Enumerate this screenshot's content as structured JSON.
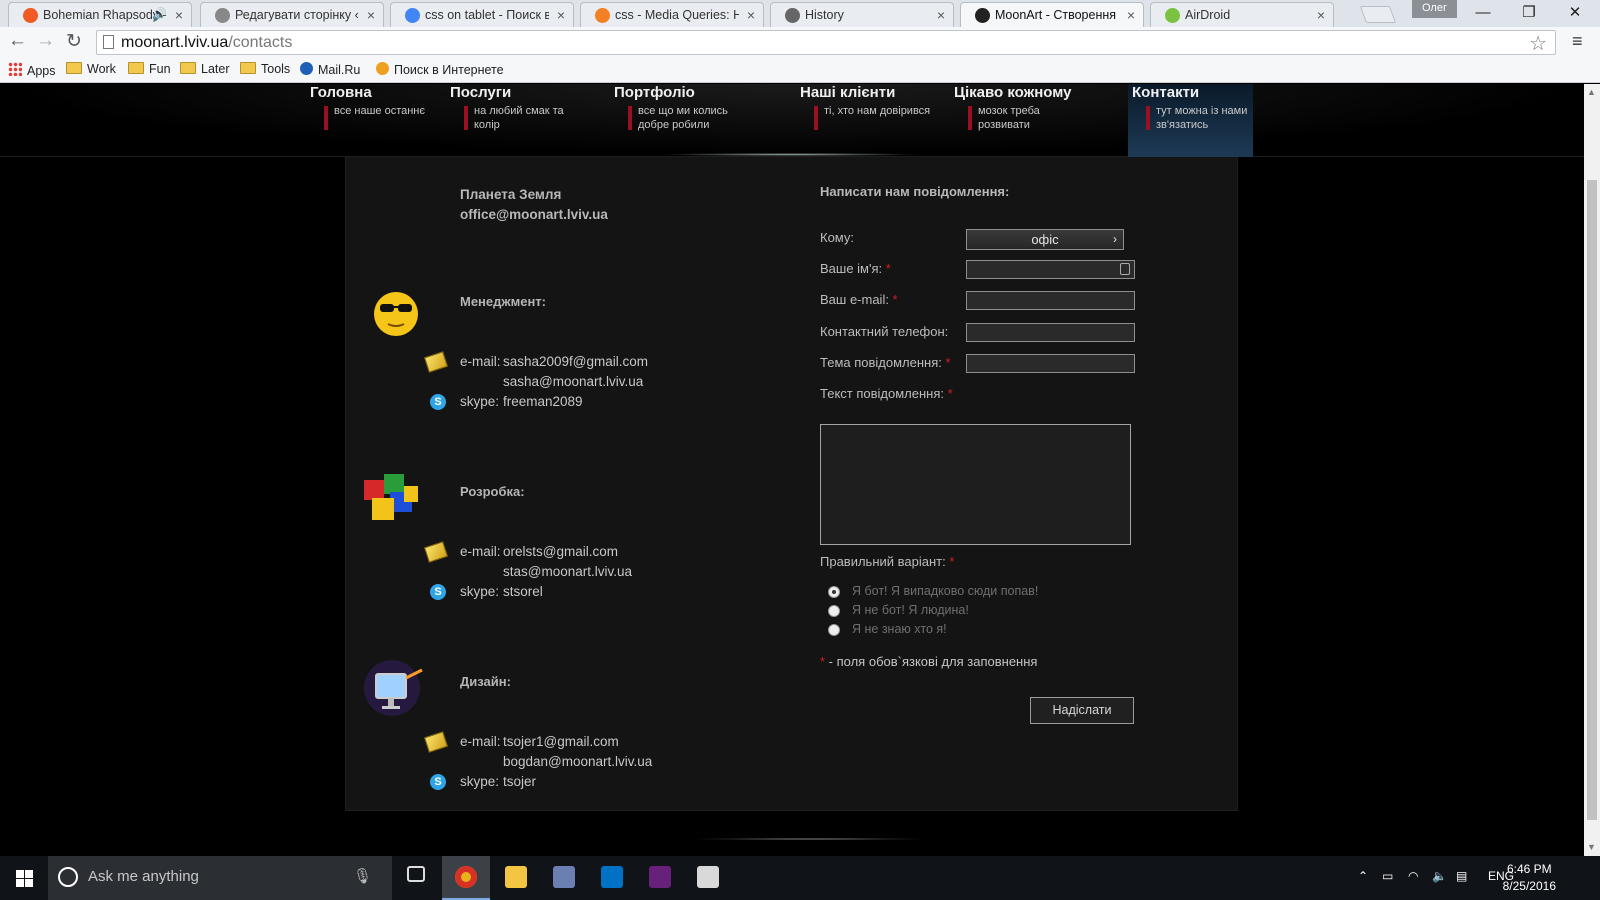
{
  "browser": {
    "tabs": [
      {
        "title": "Bohemian Rhapsody - ",
        "icon": "music-icon",
        "color": "#f15a24",
        "audio": true,
        "active": false
      },
      {
        "title": "Редагувати сторінку ‹ lux",
        "icon": "page-icon",
        "color": "#888888",
        "audio": false,
        "active": false
      },
      {
        "title": "css on tablet - Поиск в Go",
        "icon": "google-icon",
        "color": "#4285f4",
        "audio": false,
        "active": false
      },
      {
        "title": "css - Media Queries: How",
        "icon": "stackoverflow-icon",
        "color": "#f48024",
        "audio": false,
        "active": false
      },
      {
        "title": "History",
        "icon": "history-icon",
        "color": "#666666",
        "audio": false,
        "active": false
      },
      {
        "title": "MoonArt - Створення са",
        "icon": "moonart-icon",
        "color": "#222222",
        "audio": false,
        "active": true
      },
      {
        "title": "AirDroid",
        "icon": "airdroid-icon",
        "color": "#7cc242",
        "audio": false,
        "active": false
      }
    ],
    "profile_name": "Олег",
    "url_host": "moonart.lviv.ua",
    "url_path": "/contacts",
    "bookmarks": [
      {
        "label": "Apps",
        "icon": "apps-icon"
      },
      {
        "label": "Work",
        "icon": "folder-icon"
      },
      {
        "label": "Fun",
        "icon": "folder-icon"
      },
      {
        "label": "Later",
        "icon": "folder-icon"
      },
      {
        "label": "Tools",
        "icon": "folder-icon"
      },
      {
        "label": "Mail.Ru",
        "icon": "mailru-icon"
      },
      {
        "label": "Поиск в Интернете",
        "icon": "search-icon"
      }
    ]
  },
  "site": {
    "nav": [
      {
        "title": "Головна",
        "subtitle": "все наше останнє",
        "active": false
      },
      {
        "title": "Послуги",
        "subtitle": "на любий смак та колір",
        "active": false
      },
      {
        "title": "Портфоліо",
        "subtitle": "все що ми колись добре робили",
        "active": false
      },
      {
        "title": "Наші клієнти",
        "subtitle": "ті, хто нам довірився",
        "active": false
      },
      {
        "title": "Цікаво кожному",
        "subtitle": "мозок треба розвивати",
        "active": false
      },
      {
        "title": "Контакти",
        "subtitle": "тут можна із нами зв'язатись",
        "active": true
      }
    ],
    "address": "Планета Земля",
    "office_email": "office@moonart.lviv.ua",
    "teams": [
      {
        "title": "Менеджмент:",
        "icon": "smiley-sunglasses-icon",
        "email_label": "e-mail:",
        "emails": [
          "sasha2009f@gmail.com",
          "sasha@moonart.lviv.ua"
        ],
        "skype_label": "skype:",
        "skype": "freeman2089"
      },
      {
        "title": "Розробка:",
        "icon": "puzzle-icon",
        "email_label": "e-mail:",
        "emails": [
          "orelsts@gmail.com",
          "stas@moonart.lviv.ua"
        ],
        "skype_label": "skype:",
        "skype": "stsorel"
      },
      {
        "title": "Дизайн:",
        "icon": "monitor-icon",
        "email_label": "e-mail:",
        "emails": [
          "tsojer1@gmail.com",
          "bogdan@moonart.lviv.ua"
        ],
        "skype_label": "skype:",
        "skype": "tsojer"
      }
    ],
    "form": {
      "heading": "Написати нам повідомлення:",
      "to_label": "Кому:",
      "to_value": "офіс",
      "name_label": "Ваше ім'я:",
      "email_label": "Ваш e-mail:",
      "phone_label": "Контактний телефон:",
      "subject_label": "Тема повідомлення:",
      "message_label": "Текст повідомлення:",
      "captcha_label": "Правильний варіант:",
      "captcha_options": [
        "Я бот! Я випадково сюди попав!",
        "Я не бот! Я людина!",
        "Я не знаю хто я!"
      ],
      "captcha_selected": 0,
      "required_mark": "*",
      "required_note": " - поля обов`язкові для заповнення",
      "submit_label": "Надіслати"
    }
  },
  "taskbar": {
    "search_placeholder": "Ask me anything",
    "apps": [
      "task-view-icon",
      "chrome-icon",
      "file-explorer-icon",
      "lock-app-icon",
      "outlook-icon",
      "visual-studio-icon",
      "paint-icon"
    ],
    "language": "ENG",
    "time": "6:46 PM",
    "date": "8/25/2016"
  }
}
